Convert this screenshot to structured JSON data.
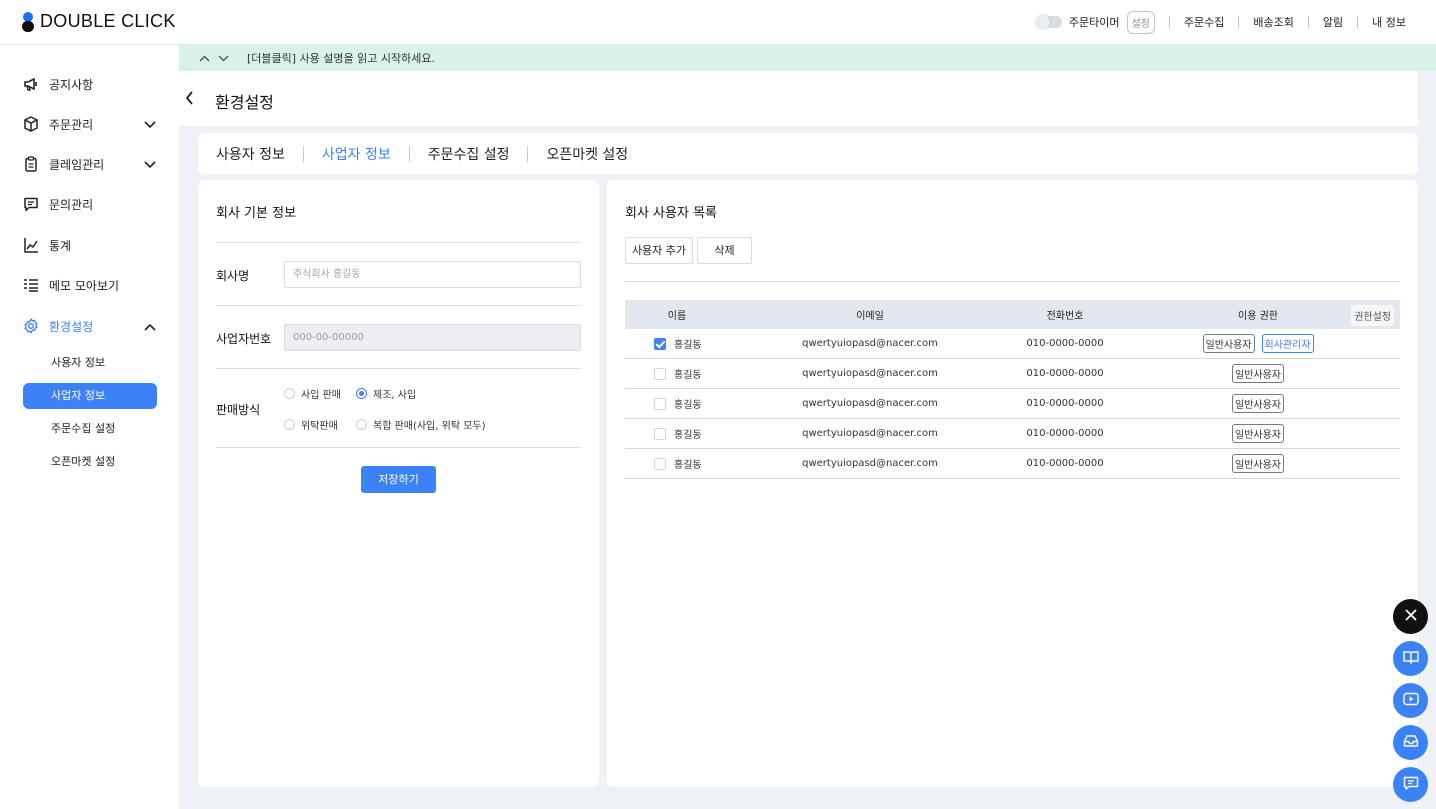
{
  "app": {
    "logo_text": "DOUBLE CLICK"
  },
  "topnav": {
    "timer_label": "주문타이머",
    "timer_setting": "설정",
    "links": [
      "주문수집",
      "배송조회",
      "알림",
      "내 정보"
    ]
  },
  "sidebar": {
    "items": [
      {
        "label": "공지사항",
        "icon": "megaphone-icon"
      },
      {
        "label": "주문관리",
        "icon": "box-icon"
      },
      {
        "label": "클레임관리",
        "icon": "clipboard-icon"
      },
      {
        "label": "문의관리",
        "icon": "message-icon"
      },
      {
        "label": "통계",
        "icon": "chart-icon"
      },
      {
        "label": "메모 모아보기",
        "icon": "memo-list-icon"
      },
      {
        "label": "환경설정",
        "icon": "gear-icon"
      }
    ],
    "sub_items": [
      "사용자 정보",
      "사업자 정보",
      "주문수집 설정",
      "오픈마켓 설정"
    ]
  },
  "notice": {
    "text": "[더블클릭] 사용 설명을 읽고 시작하세요."
  },
  "page": {
    "title": "환경설정"
  },
  "tabs": [
    "사용자 정보",
    "사업자 정보",
    "주문수집 설정",
    "오픈마켓 설정"
  ],
  "company_form": {
    "title": "회사 기본 정보",
    "company_name_label": "회사명",
    "company_name_placeholder": "주식회사 홍길동",
    "biz_number_label": "사업자번호",
    "biz_number_placeholder": "000-00-00000",
    "sales_method_label": "판매방식",
    "radios": [
      "사입 판매",
      "제조, 사입",
      "위탁판매",
      "복합 판매(사입, 위탁 모두)"
    ],
    "selected_radio": "제조, 사입",
    "save_label": "저장하기"
  },
  "user_list": {
    "title": "회사 사용자 목록",
    "add_label": "사용자 추가",
    "delete_label": "삭제",
    "headers": {
      "name": "이름",
      "email": "이메일",
      "phone": "전화번호",
      "perm": "이용 권한",
      "perm_setting": "권한설정"
    },
    "rows": [
      {
        "checked": true,
        "name": "홍길동",
        "email": "qwertyuiopasd@nacer.com",
        "phone": "010-0000-0000",
        "perms": [
          "일반사용자",
          "회사관리자"
        ]
      },
      {
        "checked": false,
        "name": "홍길동",
        "email": "qwertyuiopasd@nacer.com",
        "phone": "010-0000-0000",
        "perms": [
          "일반사용자"
        ]
      },
      {
        "checked": false,
        "name": "홍길동",
        "email": "qwertyuiopasd@nacer.com",
        "phone": "010-0000-0000",
        "perms": [
          "일반사용자"
        ]
      },
      {
        "checked": false,
        "name": "홍길동",
        "email": "qwertyuiopasd@nacer.com",
        "phone": "010-0000-0000",
        "perms": [
          "일반사용자"
        ]
      },
      {
        "checked": false,
        "name": "홍길동",
        "email": "qwertyuiopasd@nacer.com",
        "phone": "010-0000-0000",
        "perms": [
          "일반사용자"
        ]
      }
    ]
  },
  "fabs": [
    "close-icon",
    "book-icon",
    "play-icon",
    "inbox-icon",
    "chat-icon"
  ],
  "colors": {
    "accent": "#3b82f6",
    "notice_bg": "#d8f2ea",
    "page_bg": "#eef1f6"
  }
}
